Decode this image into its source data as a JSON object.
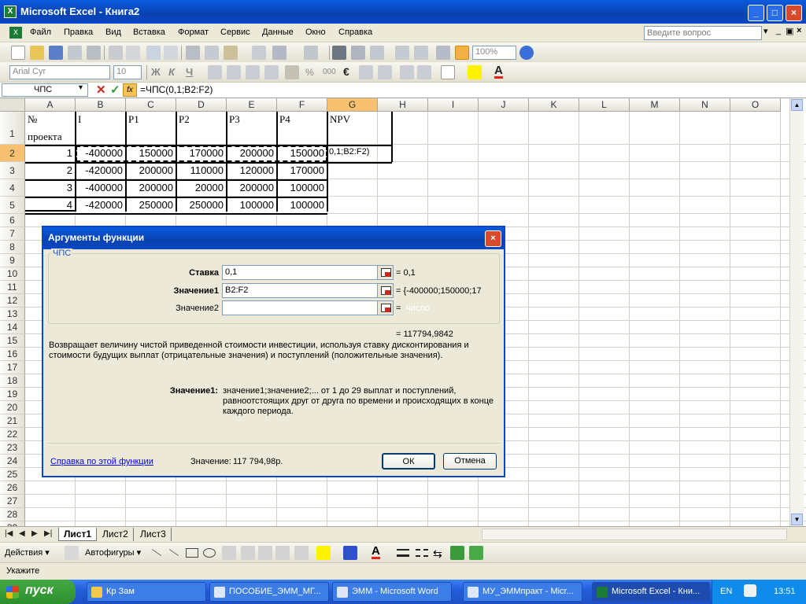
{
  "window": {
    "title": "Microsoft Excel - Книга2",
    "app_letter": "X"
  },
  "menu": {
    "items": [
      "Файл",
      "Правка",
      "Вид",
      "Вставка",
      "Формат",
      "Сервис",
      "Данные",
      "Окно",
      "Справка"
    ],
    "help_placeholder": "Введите вопрос"
  },
  "toolbar": {
    "zoom": "100%",
    "font": "Arial Cyr",
    "size": "10"
  },
  "formula_bar": {
    "name_box": "ЧПС",
    "formula": "=ЧПС(0,1;B2:F2)"
  },
  "grid": {
    "columns": [
      "A",
      "B",
      "C",
      "D",
      "E",
      "F",
      "G",
      "H",
      "I",
      "J",
      "K",
      "L",
      "M",
      "N",
      "O"
    ],
    "rows": [
      "1",
      "2",
      "3",
      "4",
      "5",
      "6",
      "7",
      "8",
      "9",
      "10",
      "11",
      "12",
      "13",
      "14",
      "15",
      "16",
      "17",
      "18",
      "19",
      "20",
      "21",
      "22",
      "23",
      "24",
      "25",
      "26",
      "27",
      "28",
      "29"
    ],
    "header_row": {
      "a_line1": "№",
      "a_line2": "проекта",
      "b": "I",
      "c": "P1",
      "d": "P2",
      "e": "P3",
      "f": "P4",
      "g": "NPV"
    },
    "data_rows": [
      [
        "1",
        "-400000",
        "150000",
        "170000",
        "200000",
        "150000"
      ],
      [
        "2",
        "-420000",
        "200000",
        "110000",
        "120000",
        "170000"
      ],
      [
        "3",
        "-400000",
        "200000",
        "20000",
        "200000",
        "100000"
      ],
      [
        "4",
        "-420000",
        "250000",
        "250000",
        "100000",
        "100000"
      ]
    ],
    "g2_text": "0,1;B2:F2)"
  },
  "dialog": {
    "title": "Аргументы функции",
    "group": "ЧПС",
    "args": [
      {
        "label": "Ставка",
        "value": "0,1",
        "result": "= 0,1"
      },
      {
        "label": "Значение1",
        "value": "B2:F2",
        "result": "= {-400000;150000;17"
      },
      {
        "label": "Значение2",
        "value": "",
        "result": "=",
        "hint": "число"
      }
    ],
    "total": "= 117794,9842",
    "description": "Возвращает величину чистой приведенной стоимости инвестиции, используя ставку дисконтирования и стоимости будущих выплат (отрицательные значения) и поступлений (положительные значения).",
    "arg_help_label": "Значение1:",
    "arg_help_text": "значение1;значение2;... от 1 до 29 выплат и поступлений, равноотстоящих друг от друга по времени и происходящих в конце каждого периода.",
    "help_link": "Справка по этой функции",
    "value_label": "Значение:",
    "value": "117 794,98р.",
    "ok": "ОК",
    "cancel": "Отмена"
  },
  "sheets": {
    "tabs": [
      "Лист1",
      "Лист2",
      "Лист3"
    ],
    "active": "Лист1"
  },
  "drawing": {
    "actions": "Действия",
    "autoshapes": "Автофигуры"
  },
  "status": {
    "text": "Укажите"
  },
  "taskbar": {
    "start": "пуск",
    "tasks": [
      "Кр Зам",
      "ПОСОБИЕ_ЭММ_МГ...",
      "ЭММ - Microsoft Word",
      "МУ_ЭММпракт - Micr...",
      "Microsoft Excel - Кни..."
    ],
    "lang": "EN",
    "clock": "13:51"
  }
}
